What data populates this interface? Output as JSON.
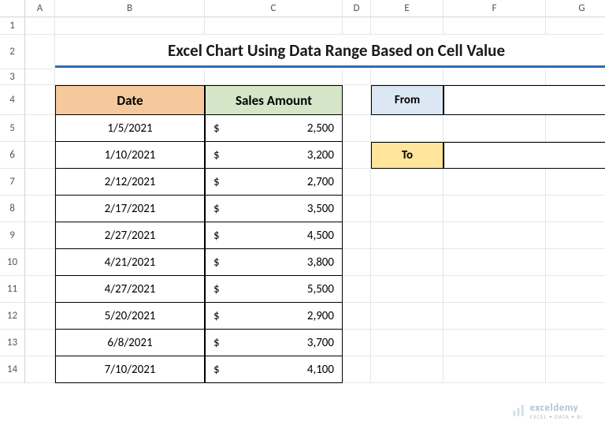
{
  "columns": [
    "A",
    "B",
    "C",
    "D",
    "E",
    "F",
    "G"
  ],
  "rows": [
    "1",
    "2",
    "3",
    "4",
    "5",
    "6",
    "7",
    "8",
    "9",
    "10",
    "11",
    "12",
    "13",
    "14"
  ],
  "title": "Excel Chart Using Data Range Based on Cell Value",
  "table": {
    "headers": {
      "date": "Date",
      "sales": "Sales Amount"
    },
    "currency_symbol": "$",
    "data": [
      {
        "date": "1/5/2021",
        "sales": "2,500"
      },
      {
        "date": "1/10/2021",
        "sales": "3,200"
      },
      {
        "date": "2/12/2021",
        "sales": "2,700"
      },
      {
        "date": "2/17/2021",
        "sales": "3,500"
      },
      {
        "date": "2/27/2021",
        "sales": "4,500"
      },
      {
        "date": "4/21/2021",
        "sales": "3,800"
      },
      {
        "date": "4/27/2021",
        "sales": "5,500"
      },
      {
        "date": "5/20/2021",
        "sales": "2,900"
      },
      {
        "date": "6/8/2021",
        "sales": "3,700"
      },
      {
        "date": "7/10/2021",
        "sales": "4,100"
      }
    ]
  },
  "filters": {
    "from_label": "From",
    "from_value": "",
    "to_label": "To",
    "to_value": ""
  },
  "watermark": {
    "brand": "exceldemy",
    "tag": "EXCEL • DATA • BI"
  }
}
